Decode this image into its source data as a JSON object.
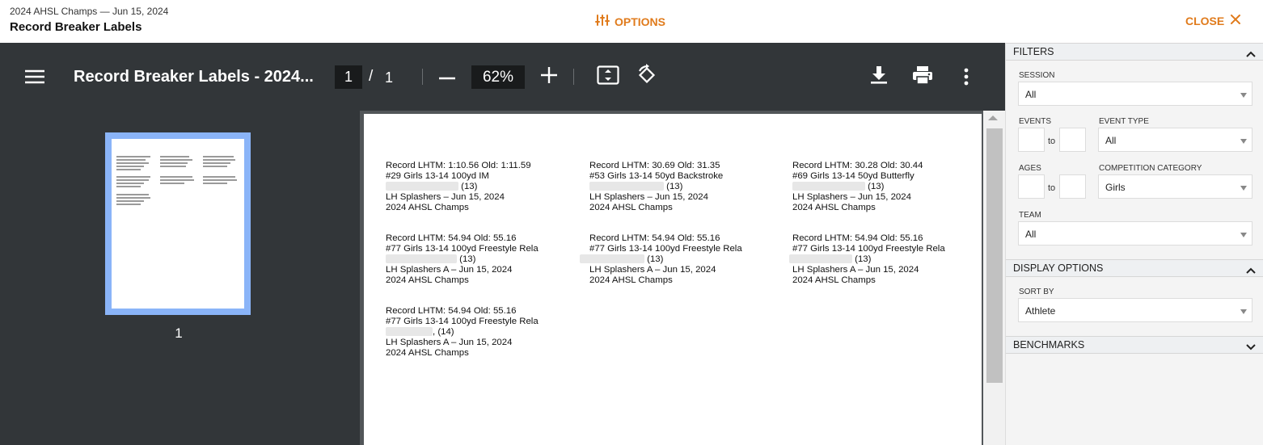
{
  "header": {
    "subtitle": "2024 AHSL Champs — Jun 15, 2024",
    "title": "Record Breaker Labels",
    "options_label": "OPTIONS",
    "close_label": "CLOSE",
    "accent_color": "#e07b1c"
  },
  "viewer": {
    "doc_title": "Record Breaker Labels - 2024...",
    "page_current": "1",
    "page_separator": "/",
    "page_total": "1",
    "zoom": "62%",
    "icons": [
      "menu-icon",
      "minus-icon",
      "plus-icon",
      "fit-page-icon",
      "rotate-icon",
      "download-icon",
      "print-icon",
      "more-vert-icon"
    ],
    "thumbnail_page_number": "1",
    "thumbnail_highlight_color": "#8ab4f8"
  },
  "labels": [
    {
      "record": "Record LHTM: 1:10.56 Old: 1:11.59",
      "event": "#29 Girls 13-14 100yd IM",
      "age": "(13)",
      "team": "LH Splashers – Jun 15, 2024",
      "meet": "2024 AHSL Champs"
    },
    {
      "record": "Record LHTM: 30.69 Old: 31.35",
      "event": "#53 Girls 13-14 50yd Backstroke",
      "age": "(13)",
      "team": "LH Splashers – Jun 15, 2024",
      "meet": "2024 AHSL Champs"
    },
    {
      "record": "Record LHTM: 30.28 Old: 30.44",
      "event": "#69 Girls 13-14 50yd Butterfly",
      "age": "(13)",
      "team": "LH Splashers – Jun 15, 2024",
      "meet": "2024 AHSL Champs"
    },
    {
      "record": "Record LHTM: 54.94 Old: 55.16",
      "event": "#77 Girls 13-14 100yd Freestyle Rela",
      "age": "(13)",
      "team": "LH Splashers A – Jun 15, 2024",
      "meet": "2024 AHSL Champs"
    },
    {
      "record": "Record LHTM: 54.94 Old: 55.16",
      "event": "#77 Girls 13-14 100yd Freestyle Rela",
      "age": "(13)",
      "team": "LH Splashers A – Jun 15, 2024",
      "meet": "2024 AHSL Champs"
    },
    {
      "record": "Record LHTM: 54.94 Old: 55.16",
      "event": "#77 Girls 13-14 100yd Freestyle Rela",
      "age": "(13)",
      "team": "LH Splashers A – Jun 15, 2024",
      "meet": "2024 AHSL Champs"
    },
    {
      "record": "Record LHTM: 54.94 Old: 55.16",
      "event": "#77 Girls 13-14 100yd Freestyle Rela",
      "age": ", (14)",
      "team": "LH Splashers A – Jun 15, 2024",
      "meet": "2024 AHSL Champs"
    }
  ],
  "panel": {
    "filters": {
      "title": "FILTERS",
      "session_label": "SESSION",
      "session_value": "All",
      "events_label": "EVENTS",
      "events_from": "",
      "events_to_label": "to",
      "events_to": "",
      "event_type_label": "EVENT TYPE",
      "event_type_value": "All",
      "ages_label": "AGES",
      "ages_from": "",
      "ages_to_label": "to",
      "ages_to": "",
      "competition_category_label": "COMPETITION CATEGORY",
      "competition_category_value": "Girls",
      "team_label": "TEAM",
      "team_value": "All"
    },
    "display_options": {
      "title": "DISPLAY OPTIONS",
      "sort_by_label": "SORT BY",
      "sort_by_value": "Athlete"
    },
    "benchmarks": {
      "title": "BENCHMARKS"
    }
  }
}
